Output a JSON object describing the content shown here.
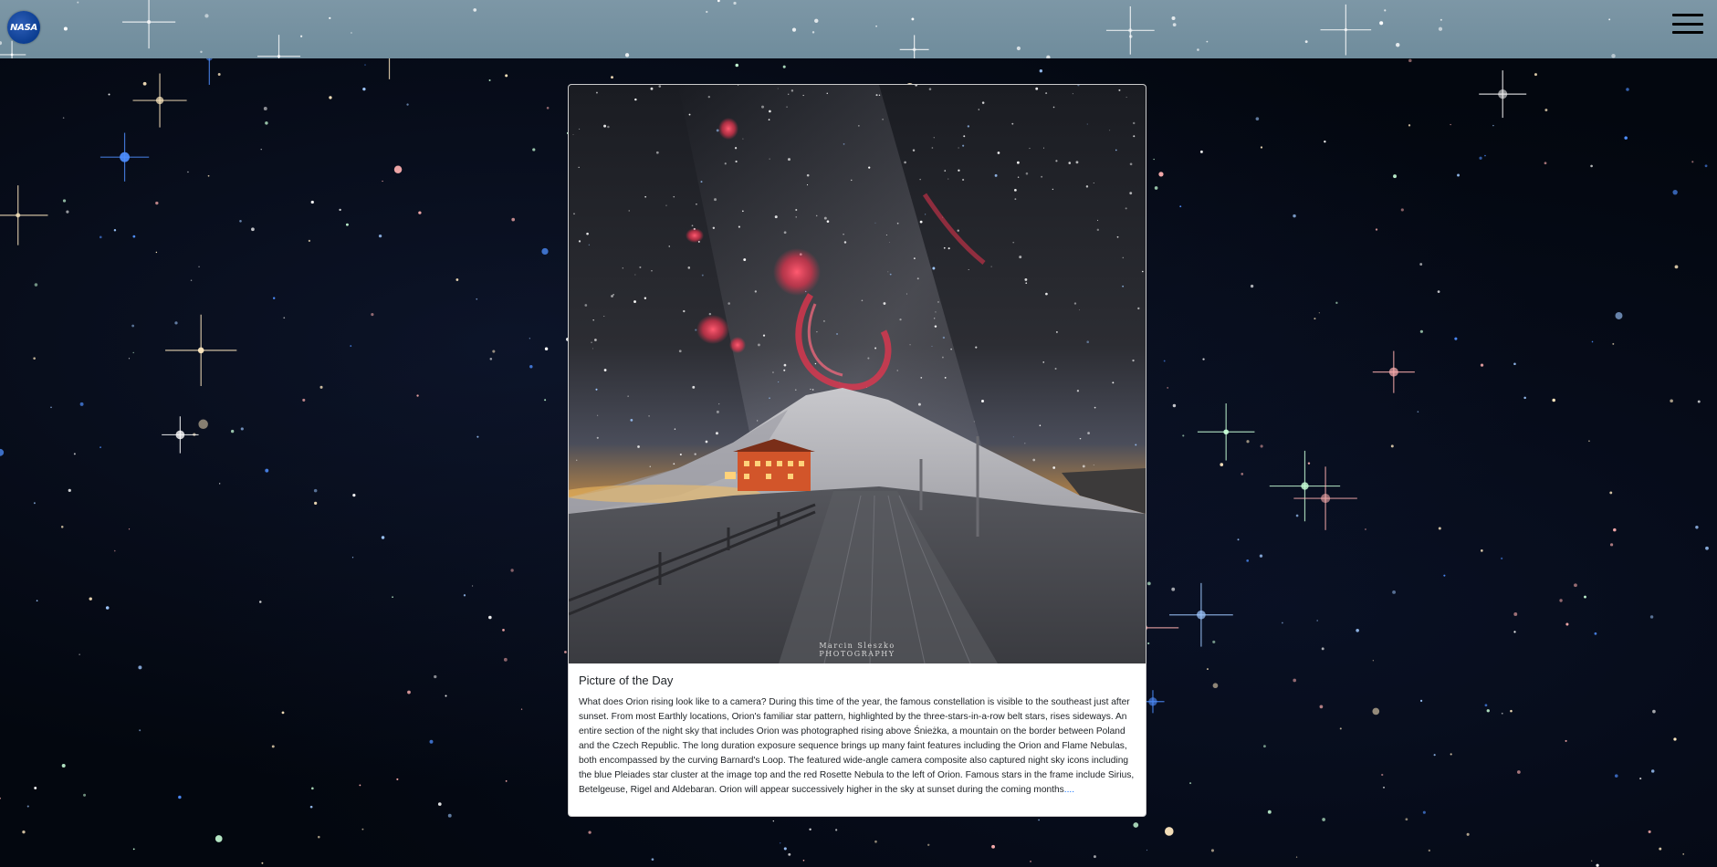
{
  "header": {
    "logo": {
      "text": "NASA",
      "icon": "nasa-logo-icon",
      "color": "#0b3d91"
    },
    "menu": {
      "icon": "hamburger-menu-icon"
    }
  },
  "card": {
    "image": {
      "alt": "Orion rising above Śnieżka",
      "credit_line1": "Marcin Sleszko",
      "credit_line2": "PHOTOGRAPHY"
    },
    "title": "Picture of the Day",
    "text": "What does Orion rising look like to a camera? During this time of the year, the famous constellation is visible to the southeast just after sunset. From most Earthly locations, Orion's familiar star pattern, highlighted by the three-stars-in-a-row belt stars, rises sideways. An entire section of the night sky that includes Orion was photographed rising above Śnieżka, a mountain on the border between Poland and the Czech Republic. The long duration exposure sequence brings up many faint features including the Orion and Flame Nebulas, both encompassed by the curving Barnard's Loop. The featured wide-angle camera composite also captured night sky icons including the blue Pleiades star cluster at the image top and the red Rosette Nebula to the left of Orion. Famous stars in the frame include Sirius, Betelgeuse, Rigel and Aldebaran. Orion will appear successively higher in the sky at sunset during the coming months",
    "read_more": "...."
  },
  "colors": {
    "header_bg": "#7d97a6",
    "page_bg": "#03070f",
    "link": "#0d6efd",
    "nebula_red": "#e8344e"
  }
}
